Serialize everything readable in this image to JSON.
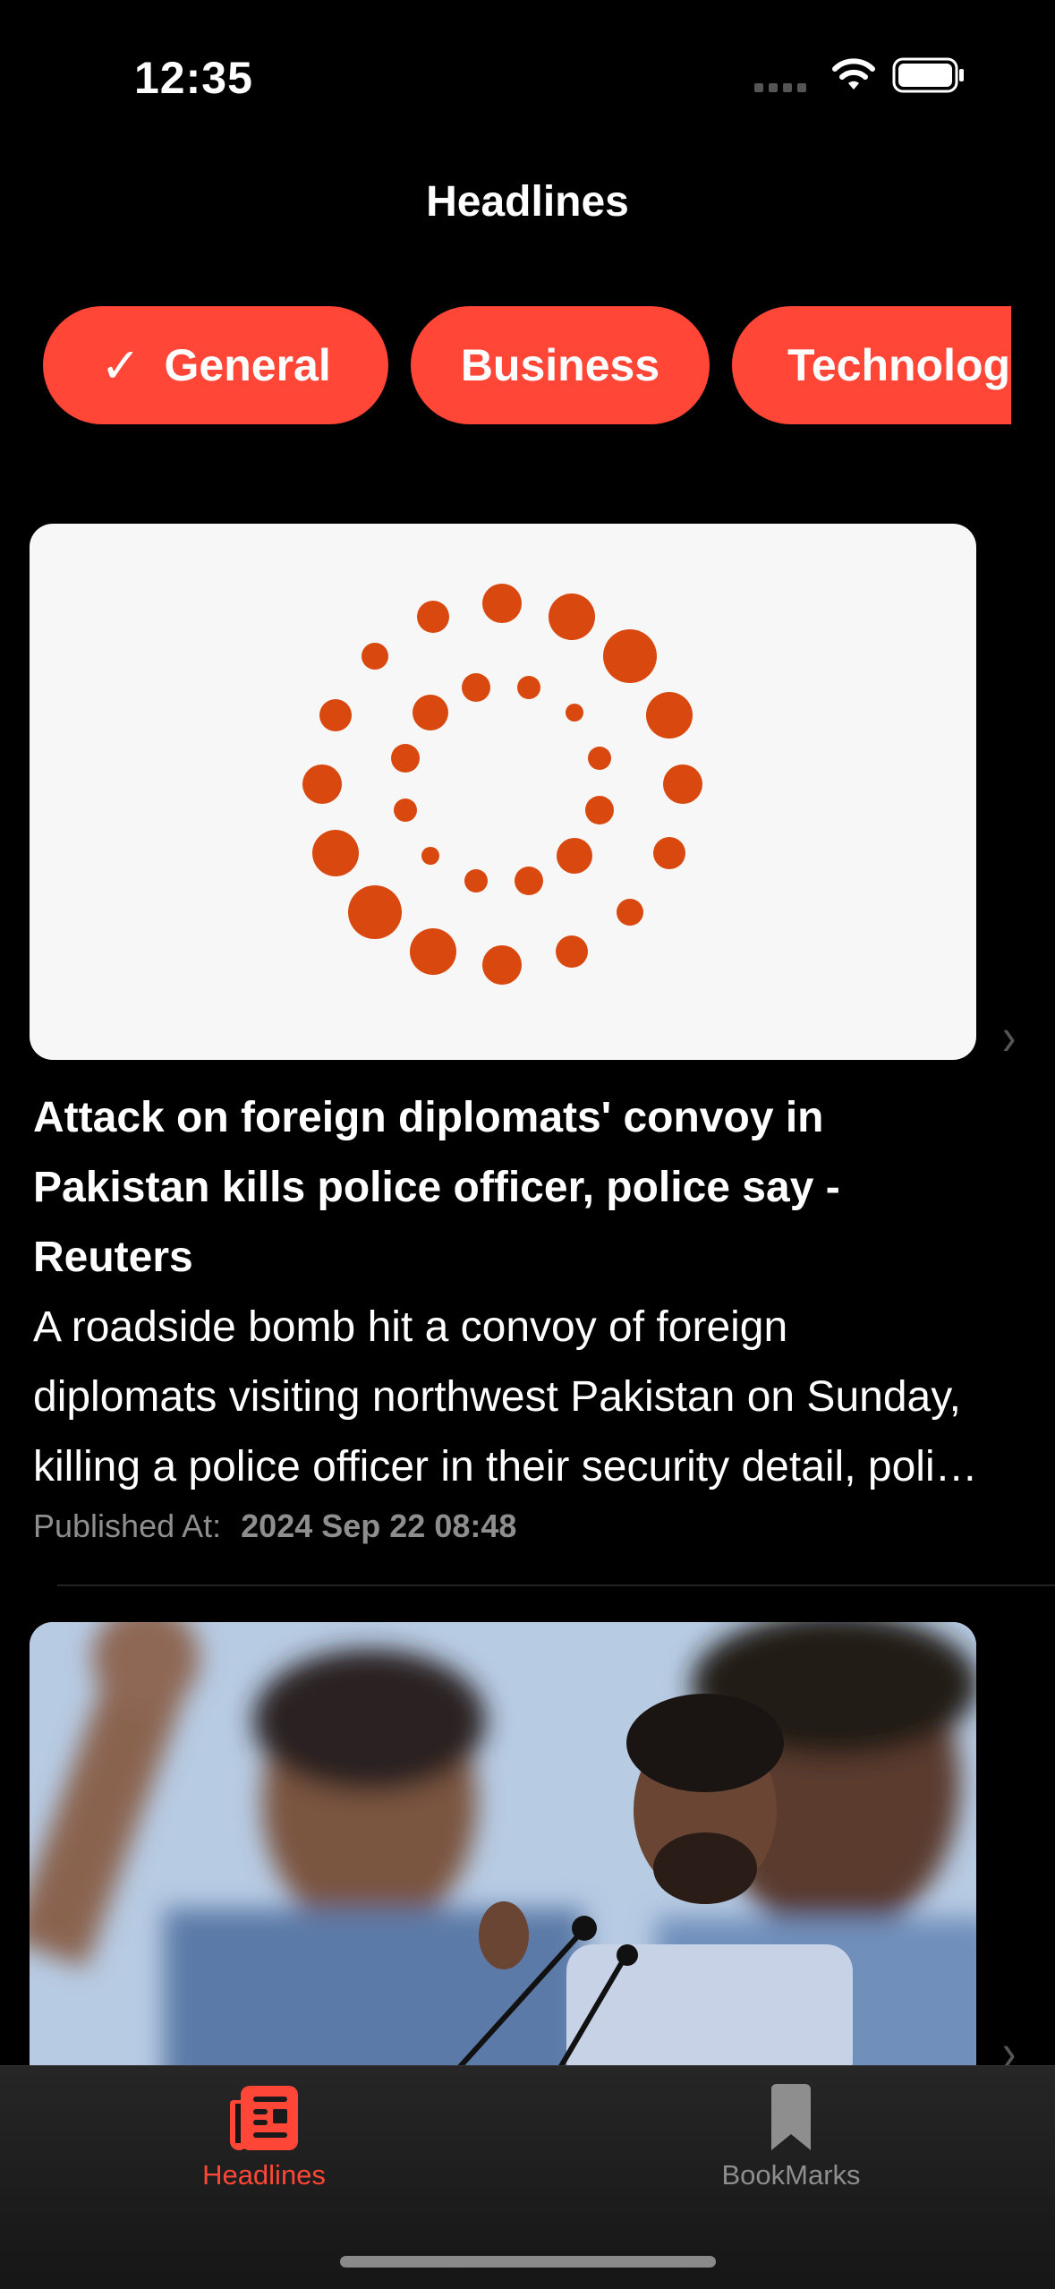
{
  "status_bar": {
    "time": "12:35"
  },
  "nav": {
    "title": "Headlines"
  },
  "categories": [
    {
      "label": "General",
      "selected": true
    },
    {
      "label": "Business",
      "selected": false
    },
    {
      "label": "Technology",
      "selected": false
    }
  ],
  "articles": [
    {
      "title": "Attack on foreign diplomats' convoy in Pakistan kills police officer, police say - Reuters",
      "description": "A roadside bomb hit a convoy of foreign diplomats visiting northwest Pakistan on Sunday, killing a police officer in their security detail, police said.",
      "published_label": "Published At:",
      "published_at": "2024 Sep 22 08:48",
      "image_icon": "reuters-logo-icon"
    },
    {
      "image_icon": "politician-speaking-photo"
    }
  ],
  "tabbar": {
    "headlines_label": "Headlines",
    "bookmarks_label": "BookMarks",
    "active": "Headlines"
  },
  "colors": {
    "accent": "#ff4637",
    "background": "#000000",
    "reuters_orange": "#dd4a10",
    "inactive": "#8e8e8e"
  }
}
